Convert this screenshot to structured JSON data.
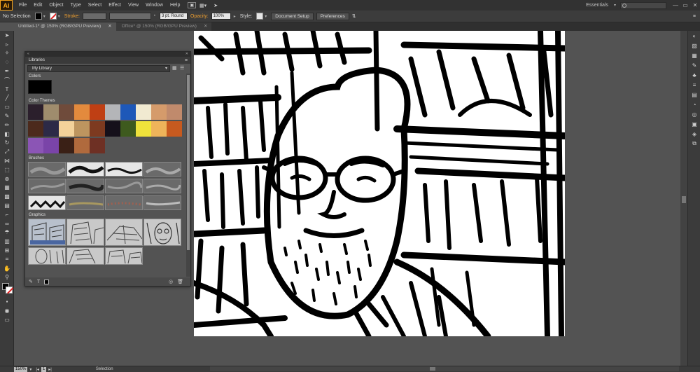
{
  "app": {
    "logo": "Ai",
    "menu": [
      "File",
      "Edit",
      "Object",
      "Type",
      "Select",
      "Effect",
      "View",
      "Window",
      "Help"
    ],
    "workspace": "Essentials",
    "window_controls": [
      "—",
      "▭",
      "✕"
    ]
  },
  "control_bar": {
    "selection": "No Selection",
    "stroke_label": "Stroke:",
    "brush_value": "3 pt. Round",
    "opacity_label": "Opacity:",
    "opacity_value": "100%",
    "style_label": "Style:",
    "document_setup": "Document Setup",
    "preferences": "Preferences"
  },
  "tabs": [
    {
      "title": "Untitled-1* @ 150% (RGB/GPU Preview)",
      "close": "✕",
      "active": true
    },
    {
      "title": "Office* @ 150% (RGB/GPU Preview)",
      "close": "✕",
      "active": false
    }
  ],
  "libraries": {
    "panel_tab": "Libraries",
    "library_name": "My Library",
    "colors_label": "Colors",
    "colors": [
      "#000000"
    ],
    "themes_label": "Color Themes",
    "theme_rows": [
      [
        "#2b1f2c",
        "#9f8c6d",
        "#6f4b3b",
        "#e38a3d",
        "#bf3f14",
        "#b4b5b8",
        "#1e58b8",
        "#f1ead1",
        "#d59b6b",
        "#c08a6c"
      ],
      [
        "#4c2a1c",
        "#2c2a47",
        "#f3d29a",
        "#bd955f",
        "#7d3a20",
        "#15101a",
        "#3e5a1e",
        "#efe23b",
        "#eeb45a",
        "#c75a1f"
      ],
      [
        "#8b55b5",
        "#7a44a8",
        "#3a2016",
        "#b06a3d",
        "#6e3024"
      ]
    ],
    "brushes_label": "Brushes",
    "graphics_label": "Graphics",
    "footer_icons": [
      "brush-icon",
      "text-icon",
      "color-icon",
      "cc-icon",
      "trash-icon"
    ]
  },
  "status": {
    "zoom": "150%",
    "page": "1",
    "mode": "Selection"
  }
}
